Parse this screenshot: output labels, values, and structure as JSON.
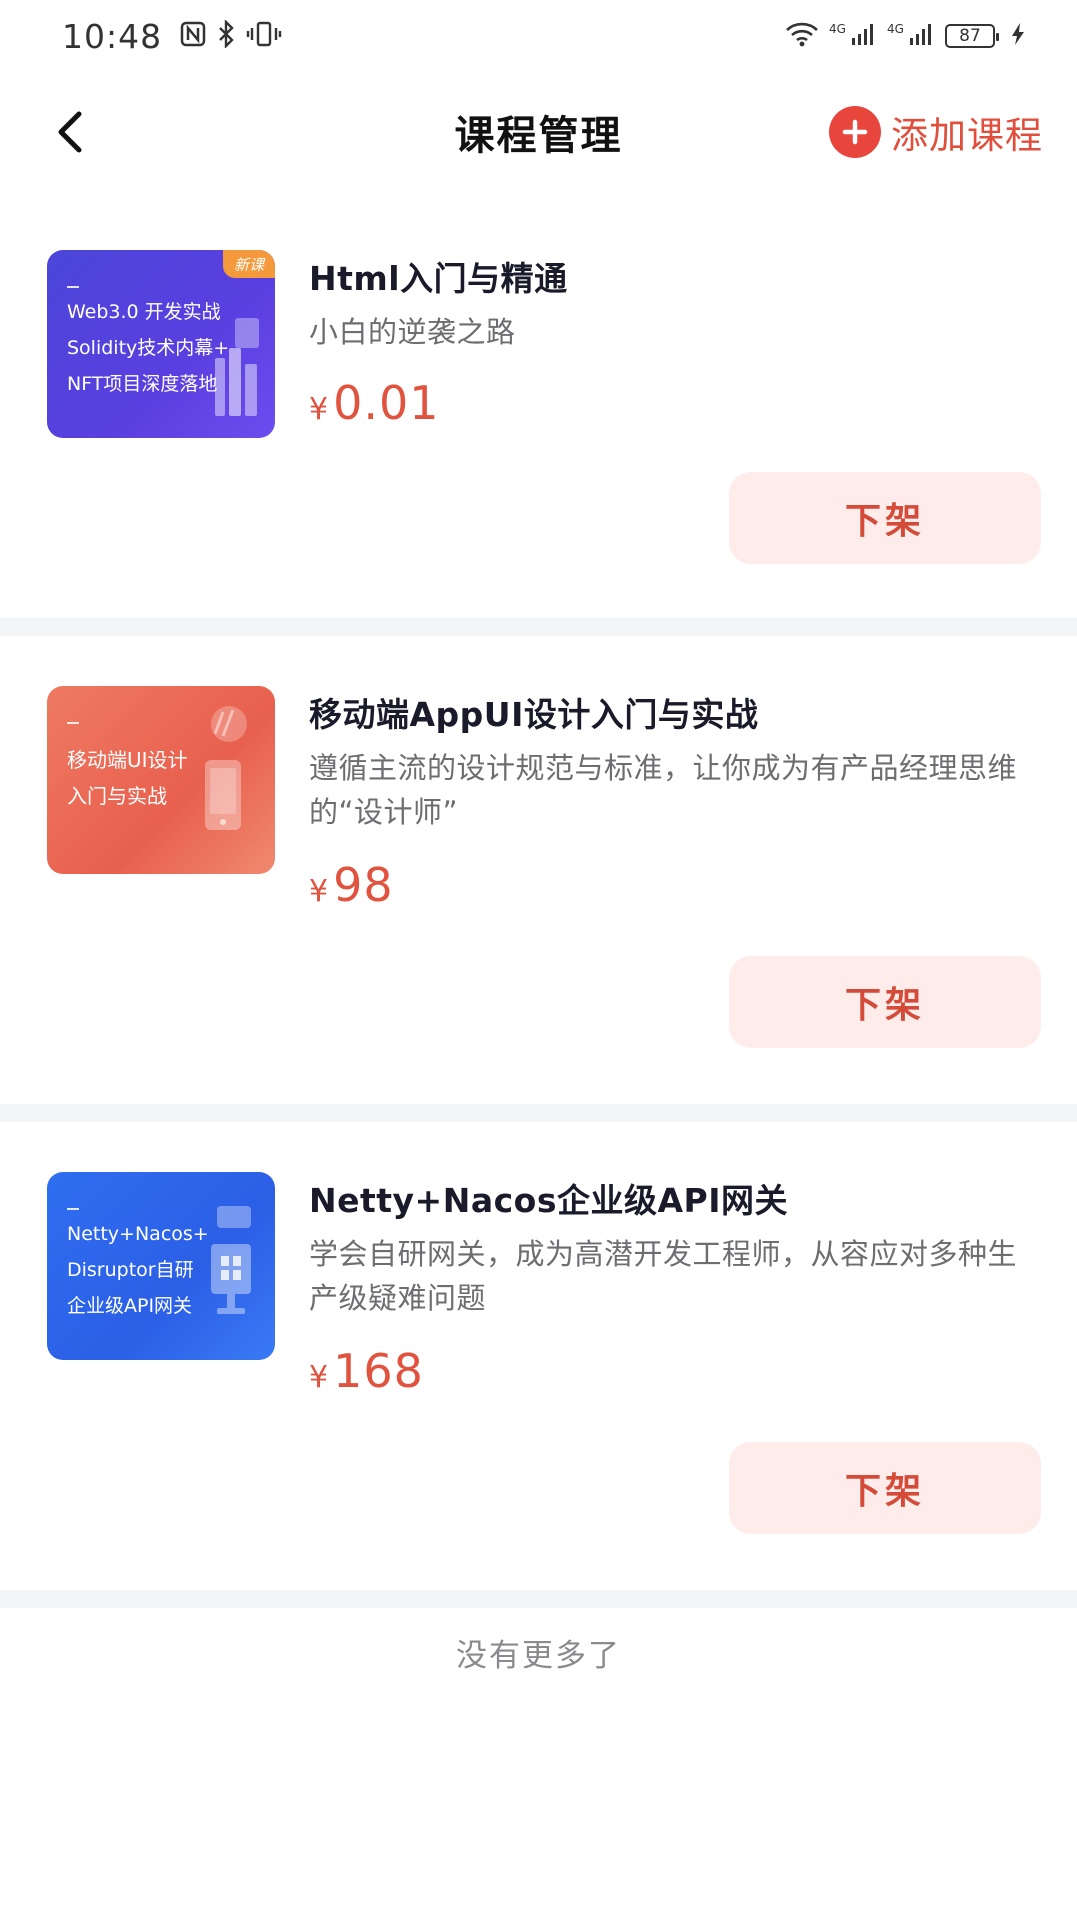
{
  "status_bar": {
    "time": "10:48",
    "battery": "87",
    "signal_label_1": "4G",
    "signal_label_2": "4G",
    "icons": [
      "nfc-icon",
      "bluetooth-icon",
      "vibrate-icon",
      "wifi-icon",
      "signal-icon",
      "signal-icon",
      "battery-icon",
      "charging-icon"
    ]
  },
  "header": {
    "title": "课程管理",
    "add_label": "添加课程"
  },
  "colors": {
    "accent": "#e14f3c",
    "button_bg": "#fdecea",
    "price": "#e0533f"
  },
  "courses": [
    {
      "title": "Html入门与精通",
      "desc": "小白的逆袭之路",
      "price": "0.01",
      "currency": "¥",
      "action": "下架",
      "thumb_text": "Web3.0 开发实战\nSolidity技术内幕+\nNFT项目深度落地",
      "thumb_badge": "新课"
    },
    {
      "title": "移动端AppUI设计入门与实战",
      "desc": "遵循主流的设计规范与标准，让你成为有产品经理思维的“设计师”",
      "price": "98",
      "currency": "¥",
      "action": "下架",
      "thumb_text": "移动端UI设计\n入门与实战"
    },
    {
      "title": "Netty+Nacos企业级API网关",
      "desc": "学会自研网关，成为高潜开发工程师，从容应对多种生产级疑难问题",
      "price": "168",
      "currency": "¥",
      "action": "下架",
      "thumb_text": "Netty+Nacos+\nDisruptor自研\n企业级API网关"
    }
  ],
  "footer": {
    "no_more": "没有更多了"
  }
}
